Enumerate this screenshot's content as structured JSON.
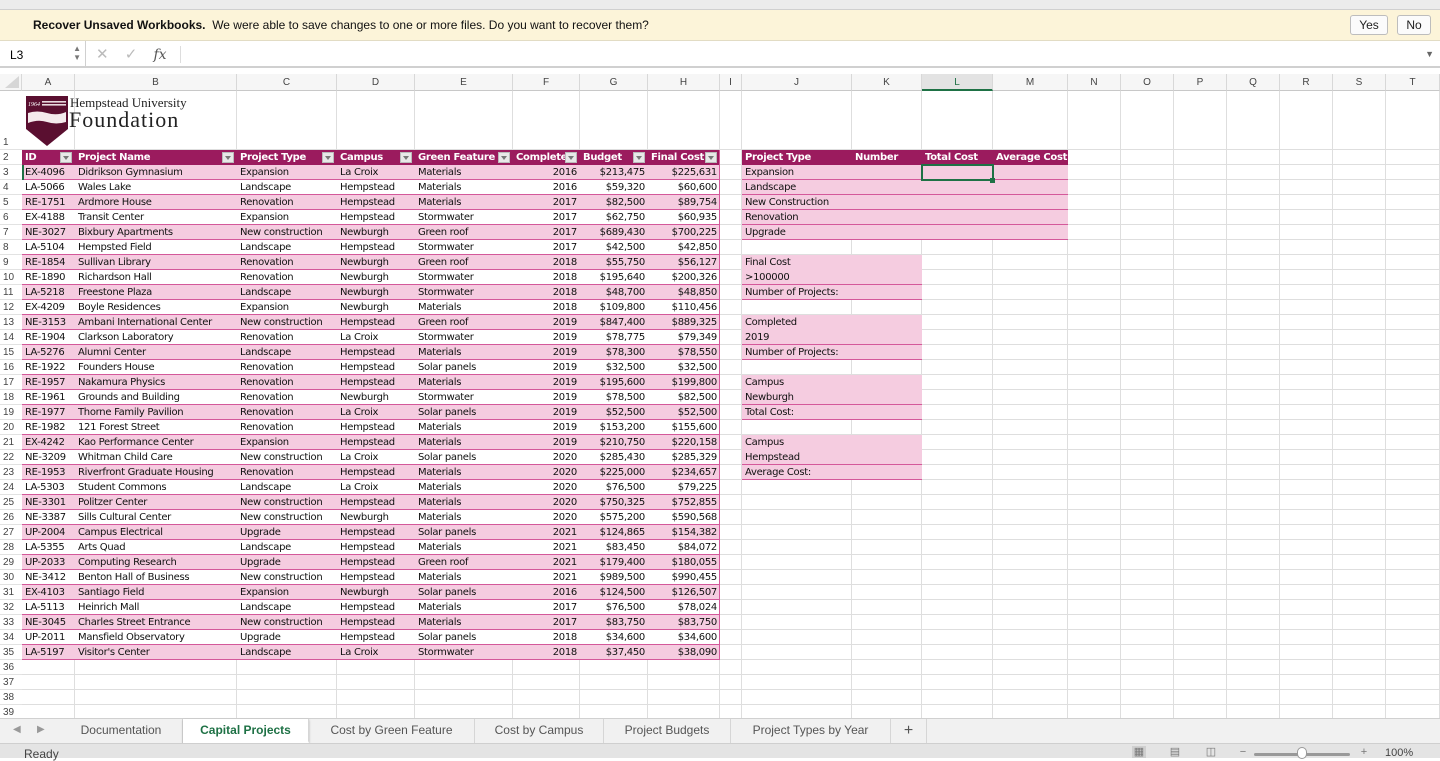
{
  "message_bar": {
    "title": "Recover Unsaved Workbooks.",
    "text": "We were able to save changes to one or more files. Do you want to recover them?",
    "yes_label": "Yes",
    "no_label": "No"
  },
  "formula_bar": {
    "name_box": "L3",
    "cancel_icon": "✕",
    "enter_icon": "✓",
    "fx_label": "fx",
    "value": ""
  },
  "columns": [
    "A",
    "B",
    "C",
    "D",
    "E",
    "F",
    "G",
    "H",
    "I",
    "J",
    "K",
    "L",
    "M",
    "N",
    "O",
    "P",
    "Q",
    "R",
    "S",
    "T"
  ],
  "selected_column": "L",
  "row_numbers": [
    "1",
    "2",
    "3",
    "4",
    "5",
    "6",
    "7",
    "8",
    "9",
    "10",
    "11",
    "12",
    "13",
    "14",
    "15",
    "16",
    "17",
    "18",
    "19",
    "20",
    "21",
    "22",
    "23",
    "24",
    "25",
    "26",
    "27",
    "28",
    "29",
    "30",
    "31",
    "32",
    "33",
    "34",
    "35",
    "36",
    "37",
    "38",
    "39"
  ],
  "logo": {
    "year": "1964",
    "line1": "Hempstead University",
    "line2": "Foundation"
  },
  "table": {
    "headers": [
      "ID",
      "Project Name",
      "Project Type",
      "Campus",
      "Green Feature",
      "Completed",
      "Budget",
      "Final Cost"
    ],
    "rows": [
      [
        "EX-4096",
        "Didrikson Gymnasium",
        "Expansion",
        "La Croix",
        "Materials",
        "2016",
        "$213,475",
        "$225,631"
      ],
      [
        "LA-5066",
        "Wales Lake",
        "Landscape",
        "Hempstead",
        "Materials",
        "2016",
        "$59,320",
        "$60,600"
      ],
      [
        "RE-1751",
        "Ardmore House",
        "Renovation",
        "Hempstead",
        "Materials",
        "2017",
        "$82,500",
        "$89,754"
      ],
      [
        "EX-4188",
        "Transit Center",
        "Expansion",
        "Hempstead",
        "Stormwater",
        "2017",
        "$62,750",
        "$60,935"
      ],
      [
        "NE-3027",
        "Bixbury Apartments",
        "New construction",
        "Newburgh",
        "Green roof",
        "2017",
        "$689,430",
        "$700,225"
      ],
      [
        "LA-5104",
        "Hempsted Field",
        "Landscape",
        "Hempstead",
        "Stormwater",
        "2017",
        "$42,500",
        "$42,850"
      ],
      [
        "RE-1854",
        "Sullivan Library",
        "Renovation",
        "Newburgh",
        "Green roof",
        "2018",
        "$55,750",
        "$56,127"
      ],
      [
        "RE-1890",
        "Richardson Hall",
        "Renovation",
        "Newburgh",
        "Stormwater",
        "2018",
        "$195,640",
        "$200,326"
      ],
      [
        "LA-5218",
        "Freestone Plaza",
        "Landscape",
        "Newburgh",
        "Stormwater",
        "2018",
        "$48,700",
        "$48,850"
      ],
      [
        "EX-4209",
        "Boyle Residences",
        "Expansion",
        "Newburgh",
        "Materials",
        "2018",
        "$109,800",
        "$110,456"
      ],
      [
        "NE-3153",
        "Ambani International Center",
        "New construction",
        "Hempstead",
        "Green roof",
        "2019",
        "$847,400",
        "$889,325"
      ],
      [
        "RE-1904",
        "Clarkson Laboratory",
        "Renovation",
        "La Croix",
        "Stormwater",
        "2019",
        "$78,775",
        "$79,349"
      ],
      [
        "LA-5276",
        "Alumni Center",
        "Landscape",
        "Hempstead",
        "Materials",
        "2019",
        "$78,300",
        "$78,550"
      ],
      [
        "RE-1922",
        "Founders House",
        "Renovation",
        "Hempstead",
        "Solar panels",
        "2019",
        "$32,500",
        "$32,500"
      ],
      [
        "RE-1957",
        "Nakamura Physics",
        "Renovation",
        "Hempstead",
        "Materials",
        "2019",
        "$195,600",
        "$199,800"
      ],
      [
        "RE-1961",
        "Grounds and Building",
        "Renovation",
        "Newburgh",
        "Stormwater",
        "2019",
        "$78,500",
        "$82,500"
      ],
      [
        "RE-1977",
        "Thorne Family Pavilion",
        "Renovation",
        "La Croix",
        "Solar panels",
        "2019",
        "$52,500",
        "$52,500"
      ],
      [
        "RE-1982",
        "121 Forest Street",
        "Renovation",
        "Hempstead",
        "Materials",
        "2019",
        "$153,200",
        "$155,600"
      ],
      [
        "EX-4242",
        "Kao Performance Center",
        "Expansion",
        "Hempstead",
        "Materials",
        "2019",
        "$210,750",
        "$220,158"
      ],
      [
        "NE-3209",
        "Whitman Child Care",
        "New construction",
        "La Croix",
        "Solar panels",
        "2020",
        "$285,430",
        "$285,329"
      ],
      [
        "RE-1953",
        "Riverfront Graduate Housing",
        "Renovation",
        "Hempstead",
        "Materials",
        "2020",
        "$225,000",
        "$234,657"
      ],
      [
        "LA-5303",
        "Student Commons",
        "Landscape",
        "La Croix",
        "Materials",
        "2020",
        "$76,500",
        "$79,225"
      ],
      [
        "NE-3301",
        "Politzer Center",
        "New construction",
        "Hempstead",
        "Materials",
        "2020",
        "$750,325",
        "$752,855"
      ],
      [
        "NE-3387",
        "Sills Cultural Center",
        "New construction",
        "Newburgh",
        "Materials",
        "2020",
        "$575,200",
        "$590,568"
      ],
      [
        "UP-2004",
        "Campus Electrical",
        "Upgrade",
        "Hempstead",
        "Solar panels",
        "2021",
        "$124,865",
        "$154,382"
      ],
      [
        "LA-5355",
        "Arts Quad",
        "Landscape",
        "Hempstead",
        "Materials",
        "2021",
        "$83,450",
        "$84,072"
      ],
      [
        "UP-2033",
        "Computing Research",
        "Upgrade",
        "Hempstead",
        "Green roof",
        "2021",
        "$179,400",
        "$180,055"
      ],
      [
        "NE-3412",
        "Benton Hall of Business",
        "New construction",
        "Hempstead",
        "Materials",
        "2021",
        "$989,500",
        "$990,455"
      ],
      [
        "EX-4103",
        "Santiago Field",
        "Expansion",
        "Newburgh",
        "Solar panels",
        "2016",
        "$124,500",
        "$126,507"
      ],
      [
        "LA-5113",
        "Heinrich Mall",
        "Landscape",
        "Hempstead",
        "Materials",
        "2017",
        "$76,500",
        "$78,024"
      ],
      [
        "NE-3045",
        "Charles Street Entrance",
        "New construction",
        "Hempstead",
        "Materials",
        "2017",
        "$83,750",
        "$83,750"
      ],
      [
        "UP-2011",
        "Mansfield Observatory",
        "Upgrade",
        "Hempstead",
        "Solar panels",
        "2018",
        "$34,600",
        "$34,600"
      ],
      [
        "LA-5197",
        "Visitor's Center",
        "Landscape",
        "La Croix",
        "Stormwater",
        "2018",
        "$37,450",
        "$38,090"
      ]
    ]
  },
  "summary": {
    "headers": [
      "Project Type",
      "Number",
      "Total Cost",
      "Average Cost"
    ],
    "types": [
      "Expansion",
      "Landscape",
      "New Construction",
      "Renovation",
      "Upgrade"
    ]
  },
  "criteria_blocks": [
    {
      "field": "Final Cost",
      "value": ">100000",
      "label": "Number of Projects:"
    },
    {
      "field": "Completed",
      "value": "2019",
      "label": "Number of Projects:"
    },
    {
      "field": "Campus",
      "value": "Newburgh",
      "label": "Total Cost:"
    },
    {
      "field": "Campus",
      "value": "Hempstead",
      "label": "Average Cost:"
    }
  ],
  "sheet_tabs": [
    {
      "label": "Documentation",
      "active": false
    },
    {
      "label": "Capital Projects",
      "active": true
    },
    {
      "label": "Cost by Green Feature",
      "active": false
    },
    {
      "label": "Cost by Campus",
      "active": false
    },
    {
      "label": "Project Budgets",
      "active": false
    },
    {
      "label": "Project Types by Year",
      "active": false
    }
  ],
  "add_sheet_label": "+",
  "status": {
    "ready": "Ready",
    "zoom": "100%",
    "zoom_level_percent": 100
  },
  "colors": {
    "header_fill": "#9b1b5e",
    "band_fill": "#f5cce0",
    "accent_green": "#1e7145"
  }
}
